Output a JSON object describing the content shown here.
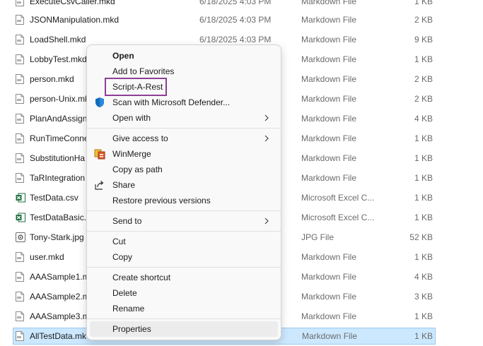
{
  "files": [
    {
      "name": "ExecuteCsvCaller.mkd",
      "date": "6/18/2025 4:03 PM",
      "type": "Markdown File",
      "size": "1 KB",
      "icon": "mkd-file-icon"
    },
    {
      "name": "JSONManipulation.mkd",
      "date": "6/18/2025 4:03 PM",
      "type": "Markdown File",
      "size": "2 KB",
      "icon": "mkd-file-icon"
    },
    {
      "name": "LoadShell.mkd",
      "date": "6/18/2025 4:03 PM",
      "type": "Markdown File",
      "size": "9 KB",
      "icon": "mkd-file-icon"
    },
    {
      "name": "LobbyTest.mkd",
      "date": "",
      "type": "Markdown File",
      "size": "1 KB",
      "icon": "mkd-file-icon"
    },
    {
      "name": "person.mkd",
      "date": "",
      "type": "Markdown File",
      "size": "2 KB",
      "icon": "mkd-file-icon"
    },
    {
      "name": "person-Unix.mkd",
      "date": "",
      "type": "Markdown File",
      "size": "2 KB",
      "icon": "mkd-file-icon"
    },
    {
      "name": "PlanAndAssign",
      "date": "",
      "type": "Markdown File",
      "size": "4 KB",
      "icon": "mkd-file-icon"
    },
    {
      "name": "RunTimeConne",
      "date": "",
      "type": "Markdown File",
      "size": "1 KB",
      "icon": "mkd-file-icon"
    },
    {
      "name": "SubstitutionHa",
      "date": "",
      "type": "Markdown File",
      "size": "1 KB",
      "icon": "mkd-file-icon"
    },
    {
      "name": "TaRIntegration",
      "date": "",
      "type": "Markdown File",
      "size": "1 KB",
      "icon": "mkd-file-icon"
    },
    {
      "name": "TestData.csv",
      "date": "",
      "type": "Microsoft Excel C...",
      "size": "1 KB",
      "icon": "excel-file-icon"
    },
    {
      "name": "TestDataBasic.c",
      "date": "",
      "type": "Microsoft Excel C...",
      "size": "1 KB",
      "icon": "excel-file-icon"
    },
    {
      "name": "Tony-Stark.jpg",
      "date": "",
      "type": "JPG File",
      "size": "52 KB",
      "icon": "image-file-icon"
    },
    {
      "name": "user.mkd",
      "date": "",
      "type": "Markdown File",
      "size": "1 KB",
      "icon": "mkd-file-icon"
    },
    {
      "name": "AAASample1.m",
      "date": "",
      "type": "Markdown File",
      "size": "4 KB",
      "icon": "mkd-file-icon"
    },
    {
      "name": "AAASample2.m",
      "date": "",
      "type": "Markdown File",
      "size": "3 KB",
      "icon": "mkd-file-icon"
    },
    {
      "name": "AAASample3.m",
      "date": "",
      "type": "Markdown File",
      "size": "1 KB",
      "icon": "mkd-file-icon"
    },
    {
      "name": "AllTestData.mk",
      "date": "",
      "type": "Markdown File",
      "size": "1 KB",
      "icon": "mkd-file-icon",
      "selected": true
    }
  ],
  "context_menu": {
    "items": [
      {
        "label": "Open",
        "bold": true
      },
      {
        "label": "Add to Favorites"
      },
      {
        "label": "Script-A-Rest",
        "highlighted": true
      },
      {
        "label": "Scan with Microsoft Defender...",
        "icon": "defender-shield-icon"
      },
      {
        "label": "Open with",
        "submenu": true
      },
      {
        "label": "Give access to",
        "submenu": true
      },
      {
        "label": "WinMerge",
        "icon": "winmerge-icon"
      },
      {
        "label": "Copy as path"
      },
      {
        "label": "Share",
        "icon": "share-icon"
      },
      {
        "label": "Restore previous versions"
      },
      {
        "label": "Send to",
        "submenu": true
      },
      {
        "label": "Cut"
      },
      {
        "label": "Copy"
      },
      {
        "label": "Create shortcut"
      },
      {
        "label": "Delete"
      },
      {
        "label": "Rename"
      },
      {
        "label": "Properties",
        "hover": true
      }
    ]
  },
  "colors": {
    "selection_bg": "#cce8ff",
    "highlight_border": "#8d3e98",
    "defender_blue": "#0f6cbd",
    "excel_green": "#1d6f42"
  }
}
